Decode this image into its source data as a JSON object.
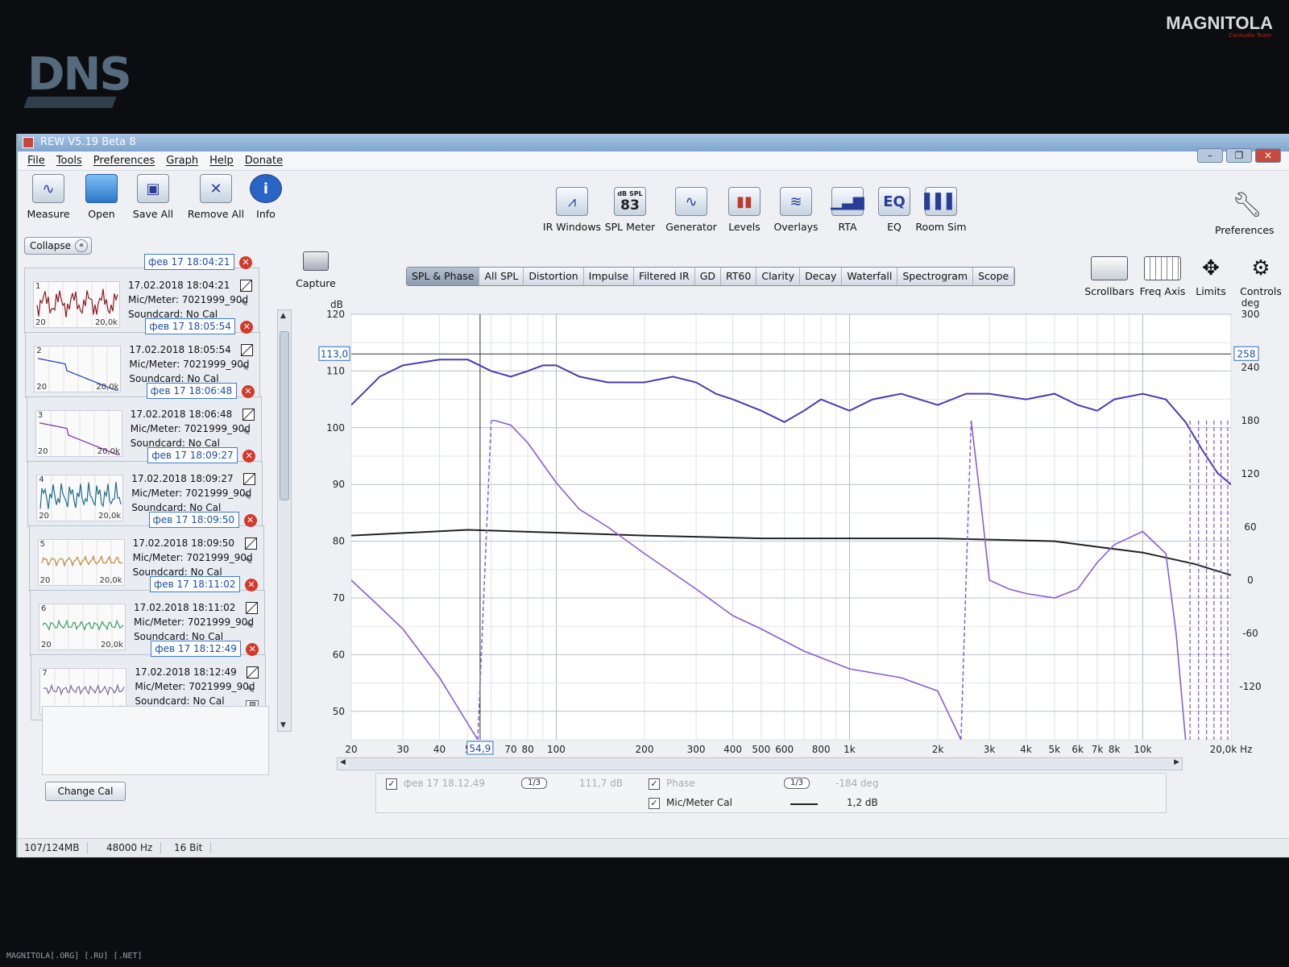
{
  "monitor": {
    "brand": "DNS",
    "watermark_top": "MAGNITOLA",
    "watermark_top_sub": "CarAudio Team",
    "watermark_bottom": "MAGNITOLA[.ORG] [.RU] [.NET]"
  },
  "window": {
    "title": "REW V5.19 Beta 8"
  },
  "menu": [
    "File",
    "Tools",
    "Preferences",
    "Graph",
    "Help",
    "Donate"
  ],
  "toolbar_left": [
    {
      "label": "Measure",
      "icon": "measure-icon"
    },
    {
      "label": "Open",
      "icon": "folder-icon"
    },
    {
      "label": "Save All",
      "icon": "save-icon"
    },
    {
      "label": "Remove All",
      "icon": "remove-all-icon"
    },
    {
      "label": "Info",
      "icon": "info-icon",
      "glyph": "i"
    }
  ],
  "toolbar_center": [
    {
      "label": "IR Windows",
      "icon": "ir-windows-icon"
    },
    {
      "label": "SPL Meter",
      "icon": "spl-meter-icon",
      "top": "dB SPL",
      "value": "83"
    },
    {
      "label": "Generator",
      "icon": "generator-icon"
    },
    {
      "label": "Levels",
      "icon": "levels-icon"
    },
    {
      "label": "Overlays",
      "icon": "overlays-icon"
    },
    {
      "label": "RTA",
      "icon": "rta-icon"
    },
    {
      "label": "EQ",
      "icon": "eq-icon",
      "glyph": "EQ"
    },
    {
      "label": "Room Sim",
      "icon": "room-sim-icon"
    }
  ],
  "toolbar_right": {
    "label": "Preferences",
    "icon": "wrench-icon"
  },
  "sidebar": {
    "collapse_label": "Collapse",
    "collapse_glyph": "«",
    "measurements": [
      {
        "num": "1",
        "name": "фев 17 18:04:21",
        "date": "17.02.2018 18:04:21",
        "mic": "Mic/Meter: 7021999_90d",
        "soundcard": "Soundcard: No Cal",
        "color": "#8b1a22"
      },
      {
        "num": "2",
        "name": "фев 17 18:05:54",
        "date": "17.02.2018 18:05:54",
        "mic": "Mic/Meter: 7021999_90d",
        "soundcard": "Soundcard: No Cal",
        "color": "#1a3fb0"
      },
      {
        "num": "3",
        "name": "фев 17 18:06:48",
        "date": "17.02.2018 18:06:48",
        "mic": "Mic/Meter: 7021999_90d",
        "soundcard": "Soundcard: No Cal",
        "color": "#7a2aa8"
      },
      {
        "num": "4",
        "name": "фев 17 18:09:27",
        "date": "17.02.2018 18:09:27",
        "mic": "Mic/Meter: 7021999_90d",
        "soundcard": "Soundcard: No Cal",
        "color": "#1f6b8f"
      },
      {
        "num": "5",
        "name": "фев 17 18:09:50",
        "date": "17.02.2018 18:09:50",
        "mic": "Mic/Meter: 7021999_90d",
        "soundcard": "Soundcard: No Cal",
        "color": "#b7893f"
      },
      {
        "num": "6",
        "name": "фев 17 18:11:02",
        "date": "17.02.2018 18:11:02",
        "mic": "Mic/Meter: 7021999_90d",
        "soundcard": "Soundcard: No Cal",
        "color": "#3f9c6a"
      },
      {
        "num": "7",
        "name": "фев 17 18:12:49",
        "date": "17.02.2018 18:12:49",
        "mic": "Mic/Meter: 7021999_90d",
        "soundcard": "Soundcard: No Cal",
        "color": "#7b6a9a"
      }
    ],
    "thumb_axis_min": "20",
    "thumb_axis_max": "20,0k",
    "change_cal_label": "Change Cal"
  },
  "capture": {
    "label": "Capture",
    "icon": "camera-icon"
  },
  "graph_tabs": [
    "SPL & Phase",
    "All SPL",
    "Distortion",
    "Impulse",
    "Filtered IR",
    "GD",
    "RT60",
    "Clarity",
    "Decay",
    "Waterfall",
    "Spectrogram",
    "Scope"
  ],
  "active_tab": "SPL & Phase",
  "graph_controls": [
    {
      "label": "Scrollbars",
      "icon": "scrollbars-icon"
    },
    {
      "label": "Freq Axis",
      "icon": "freq-axis-icon"
    },
    {
      "label": "Limits",
      "icon": "limits-icon"
    },
    {
      "label": "Controls",
      "icon": "controls-icon"
    }
  ],
  "chart_data": {
    "type": "line",
    "x_scale": "log",
    "xlim": [
      20,
      20000
    ],
    "y_left_unit": "dB",
    "y_left_lim": [
      45,
      120
    ],
    "y_left_ticks": [
      50,
      60,
      70,
      80,
      90,
      100,
      110,
      120
    ],
    "y_right_unit": "deg",
    "y_right_lim": [
      -180,
      300
    ],
    "y_right_ticks": [
      -120,
      -60,
      0,
      60,
      120,
      180,
      240,
      300
    ],
    "x_tick_labels": [
      "20",
      "30",
      "40",
      "5",
      "70",
      "80",
      "100",
      "200",
      "300",
      "400",
      "500",
      "600",
      "800",
      "1k",
      "2k",
      "3k",
      "4k",
      "5k",
      "6k",
      "7k",
      "8k",
      "10k",
      "20,0k Hz"
    ],
    "x_tick_values": [
      20,
      30,
      40,
      50,
      70,
      80,
      100,
      200,
      300,
      400,
      500,
      600,
      800,
      1000,
      2000,
      3000,
      4000,
      5000,
      6000,
      7000,
      8000,
      10000,
      20000
    ],
    "cursor": {
      "x_readout": "54,9",
      "x": 55,
      "y_readout": "113,0",
      "y": 113,
      "phase_readout": "258"
    },
    "grid": true,
    "series": [
      {
        "name": "фев 17 18.12.49",
        "axis": "left",
        "color": "#4a3bb0",
        "x": [
          20,
          25,
          30,
          40,
          50,
          60,
          70,
          80,
          90,
          100,
          120,
          150,
          200,
          250,
          300,
          350,
          400,
          500,
          600,
          700,
          800,
          1000,
          1200,
          1500,
          2000,
          2500,
          3000,
          4000,
          5000,
          6000,
          7000,
          8000,
          10000,
          12000,
          14000,
          16000,
          18000,
          20000
        ],
        "y": [
          104,
          109,
          111,
          112,
          112,
          110,
          109,
          110,
          111,
          111,
          109,
          108,
          108,
          109,
          108,
          106,
          105,
          103,
          101,
          103,
          105,
          103,
          105,
          106,
          104,
          106,
          106,
          105,
          106,
          104,
          103,
          105,
          106,
          105,
          101,
          96,
          92,
          90
        ]
      },
      {
        "name": "Mic/Meter Cal",
        "axis": "left",
        "color": "#222222",
        "x": [
          20,
          50,
          100,
          200,
          500,
          1000,
          2000,
          5000,
          7000,
          10000,
          15000,
          20000
        ],
        "y": [
          81,
          82,
          81.5,
          81,
          80.5,
          80.5,
          80.5,
          80,
          79,
          78,
          76,
          74
        ]
      },
      {
        "name": "Phase",
        "axis": "right",
        "color": "#8a5cd6",
        "dashed_wraps": true,
        "x": [
          20,
          25,
          30,
          40,
          54,
          60,
          62,
          70,
          80,
          100,
          120,
          150,
          200,
          300,
          400,
          500,
          700,
          1000,
          1500,
          2000,
          2400,
          2600,
          2800,
          3000,
          3500,
          4000,
          5000,
          6000,
          7000,
          8000,
          10000,
          12000,
          13000,
          14000
        ],
        "y": [
          0,
          -30,
          -55,
          -110,
          -180,
          180,
          180,
          175,
          155,
          110,
          80,
          60,
          30,
          -10,
          -40,
          -55,
          -80,
          -100,
          -110,
          -125,
          -180,
          180,
          90,
          0,
          -10,
          -15,
          -20,
          -10,
          20,
          40,
          55,
          30,
          -60,
          -180
        ]
      }
    ]
  },
  "legend": {
    "rows": [
      [
        {
          "checked": true,
          "label": "фев 17 18.12.49",
          "smoothing": "1/3",
          "value": "111,7 dB"
        },
        {
          "checked": true,
          "label": "Phase",
          "smoothing": "1/3",
          "value": "-184 deg"
        }
      ],
      [
        {
          "checked": true,
          "label": "Mic/Meter Cal",
          "value": "1,2 dB"
        }
      ]
    ]
  },
  "status": {
    "memory": "107/124MB",
    "rate": "48000 Hz",
    "bits": "16 Bit"
  }
}
